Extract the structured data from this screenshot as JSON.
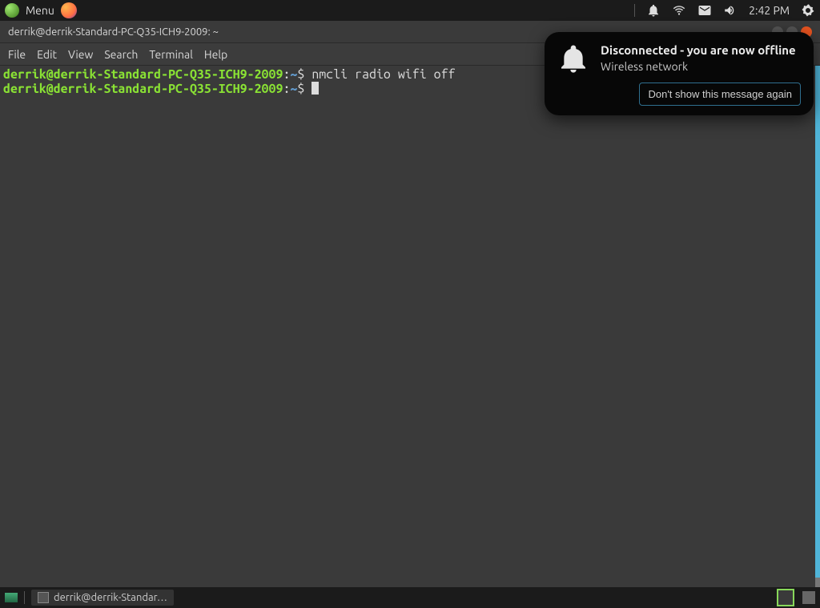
{
  "panel": {
    "menu_label": "Menu",
    "clock": "2:42 PM"
  },
  "window": {
    "title": "derrik@derrik-Standard-PC-Q35-ICH9-2009: ~"
  },
  "menubar": {
    "file": "File",
    "edit": "Edit",
    "view": "View",
    "search": "Search",
    "terminal": "Terminal",
    "help": "Help"
  },
  "terminal": {
    "line1_prompt_host": "derrik@derrik-Standard-PC-Q35-ICH9-2009",
    "line1_colon": ":",
    "line1_path": "~",
    "line1_dollar": "$ ",
    "line1_command": "nmcli radio wifi off",
    "line2_prompt_host": "derrik@derrik-Standard-PC-Q35-ICH9-2009",
    "line2_colon": ":",
    "line2_path": "~",
    "line2_dollar": "$ "
  },
  "notification": {
    "title": "Disconnected - you are now offline",
    "subtitle": "Wireless network",
    "button_label": "Don't show this message again"
  },
  "taskbar": {
    "window_label": "derrik@derrik-Standar…"
  }
}
